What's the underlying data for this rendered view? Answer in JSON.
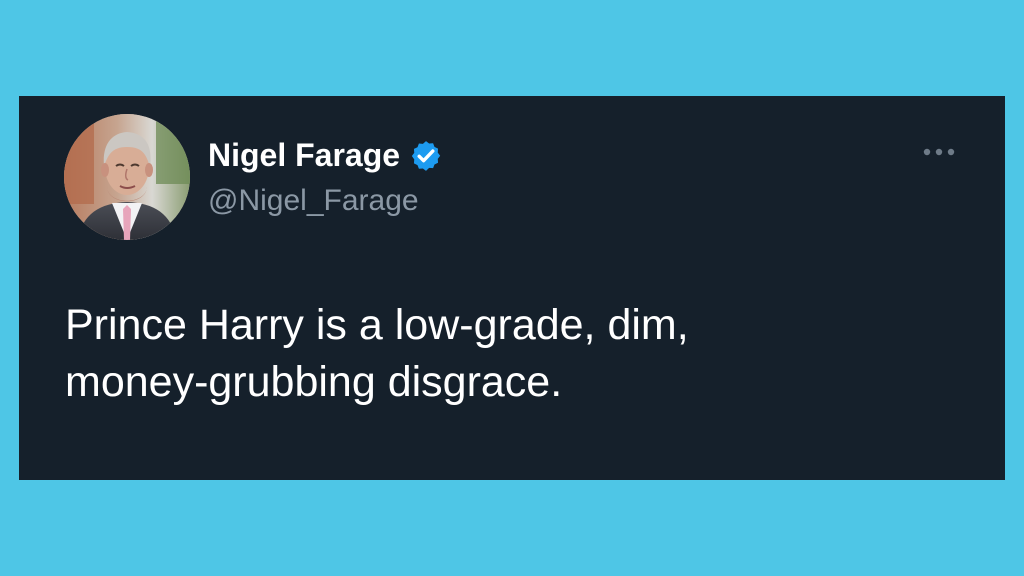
{
  "tweet": {
    "author": {
      "display_name": "Nigel Farage",
      "handle": "@Nigel_Farage",
      "verified": true,
      "avatar_icon": "profile-photo"
    },
    "text_lines": [
      "Prince Harry is a low-grade, dim,",
      "money-grubbing disgrace."
    ],
    "menu_icon": "more-options-icon"
  },
  "colors": {
    "page_background": "#4ec6e6",
    "card_background": "#15202b",
    "primary_text": "#ffffff",
    "secondary_text": "#8b98a5",
    "verified_blue": "#1d9bf0"
  }
}
